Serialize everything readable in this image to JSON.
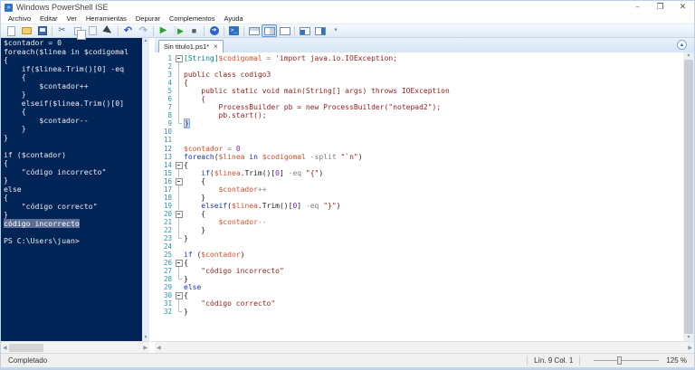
{
  "window": {
    "title": "Windows PowerShell ISE"
  },
  "window_controls": {
    "minimize": "–",
    "restore": "❐",
    "close": "✕"
  },
  "menu": {
    "items": [
      "Archivo",
      "Editar",
      "Ver",
      "Herramientas",
      "Depurar",
      "Complementos",
      "Ayuda"
    ]
  },
  "toolbar": {
    "icons": [
      {
        "name": "new-script"
      },
      {
        "name": "open-script"
      },
      {
        "name": "save"
      },
      {
        "sep": true
      },
      {
        "name": "cut",
        "glyph": "✂"
      },
      {
        "name": "copy"
      },
      {
        "name": "paste"
      },
      {
        "name": "clear-console"
      },
      {
        "sep": true
      },
      {
        "name": "undo",
        "glyph": "↶"
      },
      {
        "name": "redo",
        "glyph": "↷"
      },
      {
        "sep": true
      },
      {
        "name": "run-script",
        "glyph": "▶"
      },
      {
        "name": "run-selection",
        "glyph": "▶"
      },
      {
        "name": "stop",
        "glyph": "■"
      },
      {
        "sep": true
      },
      {
        "name": "remote-tab",
        "glyph": "➔"
      },
      {
        "sep": true
      },
      {
        "name": "start-powershell",
        "glyph": ">_"
      },
      {
        "sep": true
      },
      {
        "name": "pane-top"
      },
      {
        "name": "pane-right",
        "selected": true
      },
      {
        "name": "pane-max"
      },
      {
        "sep": true
      },
      {
        "name": "cmd-window"
      },
      {
        "name": "cmd-addon"
      },
      {
        "name": "overflow",
        "glyph": "▾"
      }
    ]
  },
  "console": {
    "bg": "#012456",
    "selection_color": "#5d6f94",
    "lines": [
      {
        "t": "$contador = 0"
      },
      {
        "t": "foreach($linea in $codigomal"
      },
      {
        "t": "{"
      },
      {
        "t": "    if($linea.Trim()[0] -eq"
      },
      {
        "t": "    {"
      },
      {
        "t": "        $contador++"
      },
      {
        "t": "    }"
      },
      {
        "t": "    elseif($linea.Trim()[0]"
      },
      {
        "t": "    {"
      },
      {
        "t": "        $contador--"
      },
      {
        "t": "    }"
      },
      {
        "t": "}"
      },
      {
        "t": ""
      },
      {
        "t": "if ($contador)"
      },
      {
        "t": "{"
      },
      {
        "t": "    \"código incorrecto\""
      },
      {
        "t": "}"
      },
      {
        "t": "else"
      },
      {
        "t": "{"
      },
      {
        "t": "    \"código correcto\""
      },
      {
        "t": "}"
      },
      {
        "t": "código incorrecto",
        "sel": true
      },
      {
        "t": ""
      },
      {
        "t": "PS C:\\Users\\juan>"
      }
    ]
  },
  "editor": {
    "tab": {
      "label": "Sin titulo1.ps1*",
      "close_glyph": "×"
    },
    "collapse_glyph": "▲",
    "lines": [
      {
        "n": 1,
        "f": "start",
        "tk": [
          {
            "t": "type",
            "v": "[String]"
          },
          {
            "t": "var",
            "v": "$codigomal"
          },
          {
            "t": "op",
            "v": " = "
          },
          {
            "t": "str",
            "v": "'import java.io.IOException;"
          }
        ]
      },
      {
        "n": 2,
        "f": "mid",
        "tk": []
      },
      {
        "n": 3,
        "f": "mid",
        "tk": [
          {
            "t": "str",
            "v": "public class codigo3"
          }
        ]
      },
      {
        "n": 4,
        "f": "mid",
        "tk": [
          {
            "t": "str",
            "v": "{"
          }
        ]
      },
      {
        "n": 5,
        "f": "mid",
        "tk": [
          {
            "t": "str",
            "v": "    public static void main(String[] args) throws IOException"
          }
        ]
      },
      {
        "n": 6,
        "f": "mid",
        "tk": [
          {
            "t": "str",
            "v": "    {"
          }
        ]
      },
      {
        "n": 7,
        "f": "mid",
        "tk": [
          {
            "t": "str",
            "v": "        ProcessBuilder pb = new ProcessBuilder(\"notepad2\");"
          }
        ]
      },
      {
        "n": 8,
        "f": "mid",
        "tk": [
          {
            "t": "str",
            "v": "        pb.start();"
          }
        ]
      },
      {
        "n": 9,
        "f": "end",
        "tk": [
          {
            "t": "caret",
            "v": "}"
          }
        ]
      },
      {
        "n": 10,
        "f": "",
        "tk": []
      },
      {
        "n": 11,
        "f": "",
        "tk": []
      },
      {
        "n": 12,
        "f": "",
        "tk": [
          {
            "t": "var",
            "v": "$contador"
          },
          {
            "t": "op",
            "v": " = "
          },
          {
            "t": "num",
            "v": "0"
          }
        ]
      },
      {
        "n": 13,
        "f": "",
        "tk": [
          {
            "t": "kw",
            "v": "foreach"
          },
          {
            "t": "plain",
            "v": "("
          },
          {
            "t": "var",
            "v": "$linea"
          },
          {
            "t": "plain",
            "v": " "
          },
          {
            "t": "kw",
            "v": "in"
          },
          {
            "t": "plain",
            "v": " "
          },
          {
            "t": "var",
            "v": "$codigomal"
          },
          {
            "t": "plain",
            "v": " "
          },
          {
            "t": "op",
            "v": "-split"
          },
          {
            "t": "plain",
            "v": " "
          },
          {
            "t": "str",
            "v": "\"`n\""
          },
          {
            "t": "plain",
            "v": ")"
          }
        ]
      },
      {
        "n": 14,
        "f": "start",
        "tk": [
          {
            "t": "plain",
            "v": "{"
          }
        ]
      },
      {
        "n": 15,
        "f": "mid",
        "tk": [
          {
            "t": "plain",
            "v": "    "
          },
          {
            "t": "kw",
            "v": "if"
          },
          {
            "t": "plain",
            "v": "("
          },
          {
            "t": "var",
            "v": "$linea"
          },
          {
            "t": "plain",
            "v": ".Trim()["
          },
          {
            "t": "num",
            "v": "0"
          },
          {
            "t": "plain",
            "v": "] "
          },
          {
            "t": "op",
            "v": "-eq"
          },
          {
            "t": "plain",
            "v": " "
          },
          {
            "t": "str",
            "v": "\"{\""
          },
          {
            "t": "plain",
            "v": ")"
          }
        ]
      },
      {
        "n": 16,
        "f": "start",
        "tk": [
          {
            "t": "plain",
            "v": "    {"
          }
        ]
      },
      {
        "n": 17,
        "f": "mid",
        "tk": [
          {
            "t": "plain",
            "v": "        "
          },
          {
            "t": "var",
            "v": "$contador"
          },
          {
            "t": "op",
            "v": "++"
          }
        ]
      },
      {
        "n": 18,
        "f": "mid",
        "tk": [
          {
            "t": "plain",
            "v": "    }"
          }
        ]
      },
      {
        "n": 19,
        "f": "mid",
        "tk": [
          {
            "t": "plain",
            "v": "    "
          },
          {
            "t": "kw",
            "v": "elseif"
          },
          {
            "t": "plain",
            "v": "("
          },
          {
            "t": "var",
            "v": "$linea"
          },
          {
            "t": "plain",
            "v": ".Trim()["
          },
          {
            "t": "num",
            "v": "0"
          },
          {
            "t": "plain",
            "v": "] "
          },
          {
            "t": "op",
            "v": "-eq"
          },
          {
            "t": "plain",
            "v": " "
          },
          {
            "t": "str",
            "v": "\"}\""
          },
          {
            "t": "plain",
            "v": ")"
          }
        ]
      },
      {
        "n": 20,
        "f": "start",
        "tk": [
          {
            "t": "plain",
            "v": "    {"
          }
        ]
      },
      {
        "n": 21,
        "f": "mid",
        "tk": [
          {
            "t": "plain",
            "v": "        "
          },
          {
            "t": "var",
            "v": "$contador"
          },
          {
            "t": "op",
            "v": "--"
          }
        ]
      },
      {
        "n": 22,
        "f": "mid",
        "tk": [
          {
            "t": "plain",
            "v": "    }"
          }
        ]
      },
      {
        "n": 23,
        "f": "end",
        "tk": [
          {
            "t": "plain",
            "v": "}"
          }
        ]
      },
      {
        "n": 24,
        "f": "",
        "tk": []
      },
      {
        "n": 25,
        "f": "",
        "tk": [
          {
            "t": "kw",
            "v": "if"
          },
          {
            "t": "plain",
            "v": " ("
          },
          {
            "t": "var",
            "v": "$contador"
          },
          {
            "t": "plain",
            "v": ")"
          }
        ]
      },
      {
        "n": 26,
        "f": "start",
        "tk": [
          {
            "t": "plain",
            "v": "{"
          }
        ]
      },
      {
        "n": 27,
        "f": "mid",
        "tk": [
          {
            "t": "plain",
            "v": "    "
          },
          {
            "t": "str",
            "v": "\"código incorrecto\""
          }
        ]
      },
      {
        "n": 28,
        "f": "end",
        "tk": [
          {
            "t": "plain",
            "v": "}"
          }
        ]
      },
      {
        "n": 29,
        "f": "",
        "tk": [
          {
            "t": "kw",
            "v": "else"
          }
        ]
      },
      {
        "n": 30,
        "f": "start",
        "tk": [
          {
            "t": "plain",
            "v": "{"
          }
        ]
      },
      {
        "n": 31,
        "f": "mid",
        "tk": [
          {
            "t": "plain",
            "v": "    "
          },
          {
            "t": "str",
            "v": "\"código correcto\""
          }
        ]
      },
      {
        "n": 32,
        "f": "end",
        "tk": [
          {
            "t": "plain",
            "v": "}"
          }
        ]
      }
    ]
  },
  "statusbar": {
    "status": "Completado",
    "position": "Lín. 9 Col. 1",
    "zoom_label": "125 %"
  }
}
